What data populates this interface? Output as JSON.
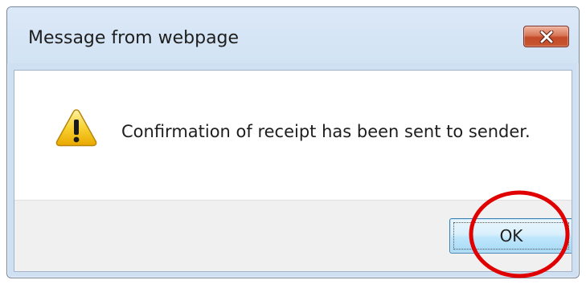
{
  "window": {
    "title": "Message from webpage",
    "close_icon": "close-x-icon"
  },
  "message": {
    "icon": "warning-icon",
    "text": "Confirmation of receipt has been sent to sender."
  },
  "buttons": {
    "ok_label": "OK"
  },
  "annotation": {
    "shape": "circle",
    "color": "#e00000",
    "target": "OK button"
  },
  "colors": {
    "title_bar": "#d2e3f4",
    "close_button": "#c95532",
    "ok_button": "#bee6fd",
    "warning_yellow": "#f5c400"
  }
}
